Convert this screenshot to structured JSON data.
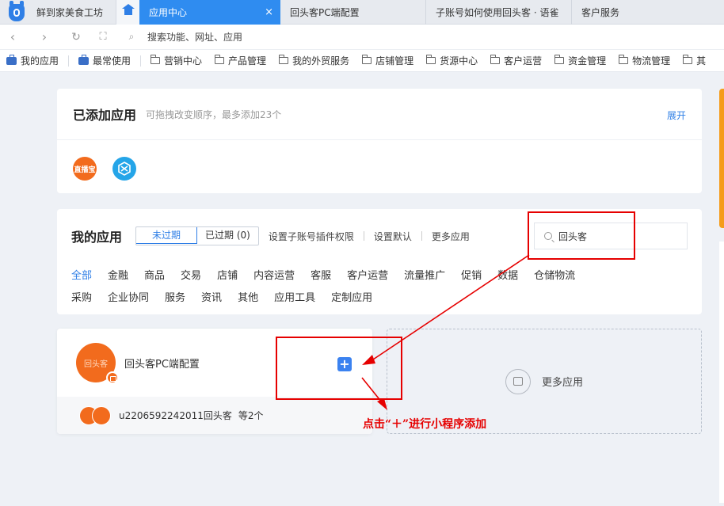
{
  "browser": {
    "first_tab": "鲜到家美食工坊",
    "tabs": [
      {
        "label": "应用中心",
        "active": true,
        "close": "×"
      },
      {
        "label": "回头客PC端配置",
        "active": false
      },
      {
        "label": "子账号如何使用回头客 · 语雀",
        "active": false
      },
      {
        "label": "客户服务",
        "active": false
      }
    ],
    "address_placeholder": "搜索功能、网址、应用",
    "bookmarks": [
      "我的应用",
      "最常使用",
      "营销中心",
      "产品管理",
      "我的外贸服务",
      "店铺管理",
      "货源中心",
      "客户运营",
      "资金管理",
      "物流管理",
      "其"
    ]
  },
  "added_apps": {
    "title": "已添加应用",
    "subtitle": "可拖拽改变顺序，最多添加23个",
    "expand": "展开",
    "icon1_text": "直播宝"
  },
  "my_apps": {
    "title": "我的应用",
    "filters": [
      "未过期",
      "已过期 (0)"
    ],
    "links": [
      "设置子账号插件权限",
      "设置默认",
      "更多应用"
    ],
    "search_value": "回头客",
    "categories_row1": [
      "全部",
      "金融",
      "商品",
      "交易",
      "店铺",
      "内容运营",
      "客服",
      "客户运营",
      "流量推广",
      "促销",
      "数据",
      "仓储物流"
    ],
    "categories_row2": [
      "采购",
      "企业协同",
      "服务",
      "资讯",
      "其他",
      "应用工具",
      "定制应用"
    ]
  },
  "app_card": {
    "name": "回头客PC端配置",
    "logo_text": "回头客",
    "plus": "+",
    "account": "u2206592242011回头客",
    "more_count": "等2个"
  },
  "more_apps_card": {
    "label": "更多应用"
  },
  "annotation": {
    "text": "点击“＋”进行小程序添加",
    "color": "#e60000"
  }
}
